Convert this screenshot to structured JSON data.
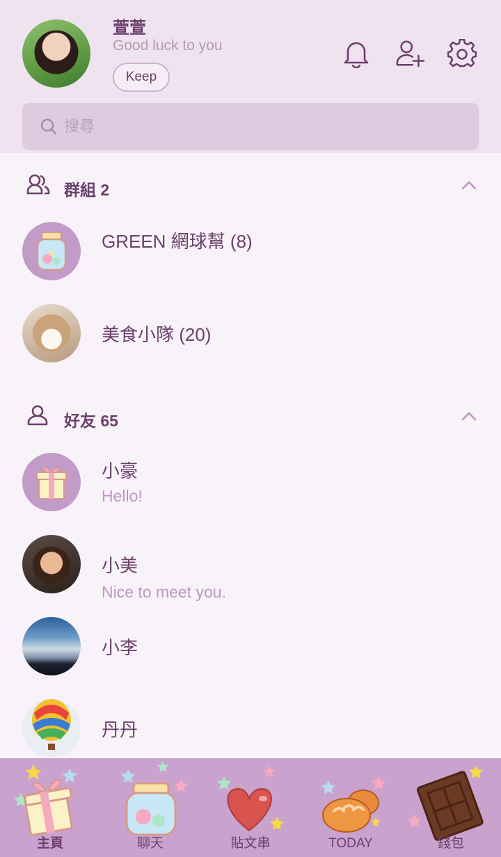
{
  "profile": {
    "name": "萱萱",
    "status": "Good luck to you",
    "keep_label": "Keep"
  },
  "search": {
    "placeholder": "搜尋"
  },
  "groups": {
    "title": "群組 2",
    "items": [
      {
        "name": "GREEN 網球幫 (8)",
        "avatar": "candy-jar"
      },
      {
        "name": "美食小隊 (20)",
        "avatar": "cat-photo"
      }
    ]
  },
  "friends": {
    "title": "好友 65",
    "items": [
      {
        "name": "小豪",
        "message": "Hello!",
        "avatar": "gift-box"
      },
      {
        "name": "小美",
        "message": "Nice to meet you.",
        "avatar": "woman-photo"
      },
      {
        "name": "小李",
        "message": "",
        "avatar": "sky-photo"
      },
      {
        "name": "丹丹",
        "message": "",
        "avatar": "balloon-photo"
      }
    ]
  },
  "nav": {
    "items": [
      {
        "label": "主頁",
        "icon": "gift-icon",
        "active": true
      },
      {
        "label": "聊天",
        "icon": "candy-jar-icon"
      },
      {
        "label": "貼文串",
        "icon": "heart-icon"
      },
      {
        "label": "TODAY",
        "icon": "bread-icon"
      },
      {
        "label": "錢包",
        "icon": "chocolate-icon"
      }
    ]
  },
  "colors": {
    "header_bg": "#f0e3f0",
    "page_bg": "#f8f3f8",
    "accent": "#6b3f6b",
    "subtext": "#c094c6",
    "nav_bg": "#c9a3cd",
    "avatar_bg": "#c29bc8"
  }
}
